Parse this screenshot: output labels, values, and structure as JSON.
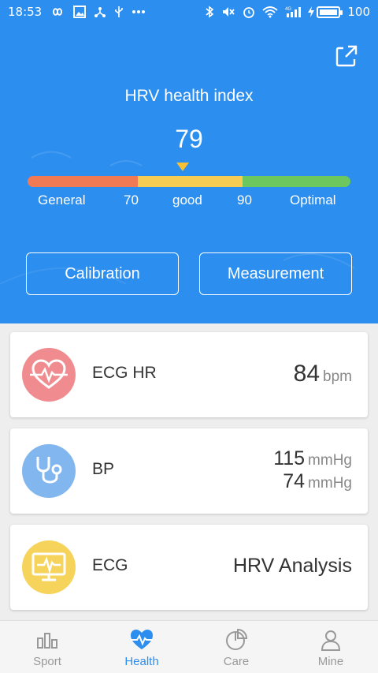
{
  "status_bar": {
    "time": "18:53",
    "battery": "100",
    "signal_label": "4G",
    "icons_left": [
      "infinity-icon",
      "image-icon",
      "share-network-icon",
      "usb-icon",
      "more-dots-icon"
    ],
    "icons_right": [
      "bluetooth-icon",
      "mute-icon",
      "alarm-icon",
      "wifi-icon",
      "signal-icon",
      "charging-icon",
      "battery-icon"
    ]
  },
  "header": {
    "title": "HRV health index",
    "value": "79",
    "share_icon": "share-icon",
    "scale": {
      "labels": [
        "General",
        "70",
        "good",
        "90",
        "Optimal"
      ],
      "colors": [
        "#f07a54",
        "#f6cc52",
        "#6cc85e"
      ],
      "indicator_color": "#f7c133"
    },
    "buttons": {
      "calibration": "Calibration",
      "measurement": "Measurement"
    },
    "background_color": "#2c8eee"
  },
  "cards": {
    "ecg_hr": {
      "label": "ECG HR",
      "value": "84",
      "unit": "bpm",
      "icon": "heart-ecg-icon",
      "icon_color": "#f08c8f"
    },
    "bp": {
      "label": "BP",
      "systolic": "115",
      "diastolic": "74",
      "unit": "mmHg",
      "icon": "stethoscope-icon",
      "icon_color": "#82b6ee"
    },
    "ecg": {
      "label": "ECG",
      "value": "HRV Analysis",
      "icon": "ecg-monitor-icon",
      "icon_color": "#f6d35b"
    }
  },
  "nav": {
    "items": [
      {
        "label": "Sport",
        "icon": "bar-chart-icon",
        "active": false
      },
      {
        "label": "Health",
        "icon": "heart-pulse-icon",
        "active": true
      },
      {
        "label": "Care",
        "icon": "pie-chart-icon",
        "active": false
      },
      {
        "label": "Mine",
        "icon": "user-icon",
        "active": false
      }
    ],
    "active_color": "#2c8eee",
    "inactive_color": "#999999"
  }
}
